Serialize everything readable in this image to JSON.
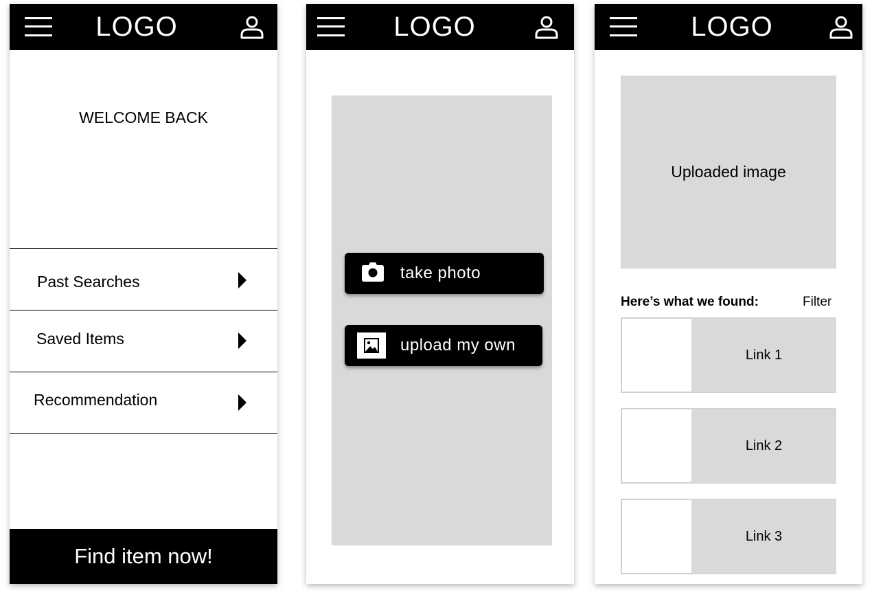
{
  "screens": [
    {
      "header": {
        "logo": "LOGO",
        "menu_icon": "hamburger-menu-icon",
        "profile_icon": "user-icon"
      },
      "welcome": "WELCOME BACK",
      "menu_items": [
        {
          "label": "Past Searches",
          "icon": "chevron-right-icon"
        },
        {
          "label": "Saved Items",
          "icon": "chevron-right-icon"
        },
        {
          "label": "Recommendation",
          "icon": "chevron-right-icon"
        }
      ],
      "cta": "Find item now!"
    },
    {
      "header": {
        "logo": "LOGO",
        "menu_icon": "hamburger-menu-icon",
        "profile_icon": "user-icon"
      },
      "actions": [
        {
          "label": "take photo",
          "icon": "camera-icon"
        },
        {
          "label": "upload my own",
          "icon": "image-icon"
        }
      ]
    },
    {
      "header": {
        "logo": "LOGO",
        "menu_icon": "hamburger-menu-icon",
        "profile_icon": "user-icon"
      },
      "preview_label": "Uploaded image",
      "results_title": "Here’s what we found:",
      "filter": "Filter",
      "results": [
        {
          "label": "Link 1"
        },
        {
          "label": "Link 2"
        },
        {
          "label": "Link 3"
        }
      ]
    }
  ],
  "colors": {
    "bar": "#000000",
    "placeholder": "#d9d9d9",
    "text_on_dark": "#ffffff"
  }
}
